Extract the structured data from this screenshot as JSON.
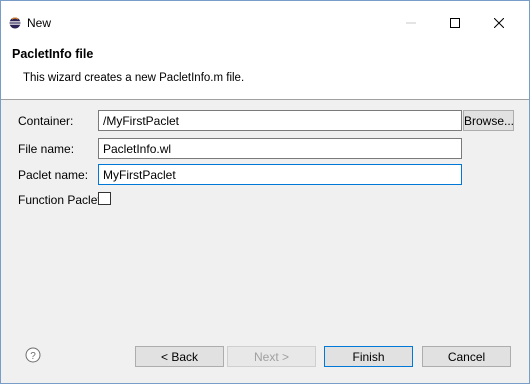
{
  "window": {
    "title": "New"
  },
  "header": {
    "title": "PacletInfo file",
    "description": "This wizard creates a new PacletInfo.m file."
  },
  "form": {
    "container_label": "Container:",
    "container_value": "/MyFirstPaclet",
    "browse_label": "Browse...",
    "filename_label": "File name:",
    "filename_value": "PacletInfo.wl",
    "pacletname_label": "Paclet name:",
    "pacletname_value": "MyFirstPaclet",
    "function_paclet_label": "Function Paclet:",
    "function_paclet_checked": false
  },
  "footer": {
    "back_label": "< Back",
    "next_label": "Next >",
    "finish_label": "Finish",
    "cancel_label": "Cancel"
  },
  "icons": {
    "app": "eclipse-icon",
    "help": "help-icon",
    "minimize": "minimize-icon",
    "maximize": "maximize-icon",
    "close": "close-icon"
  },
  "colors": {
    "focus_border": "#0078d7",
    "dialog_bg": "#f0f0f0",
    "header_bg": "#ffffff"
  }
}
